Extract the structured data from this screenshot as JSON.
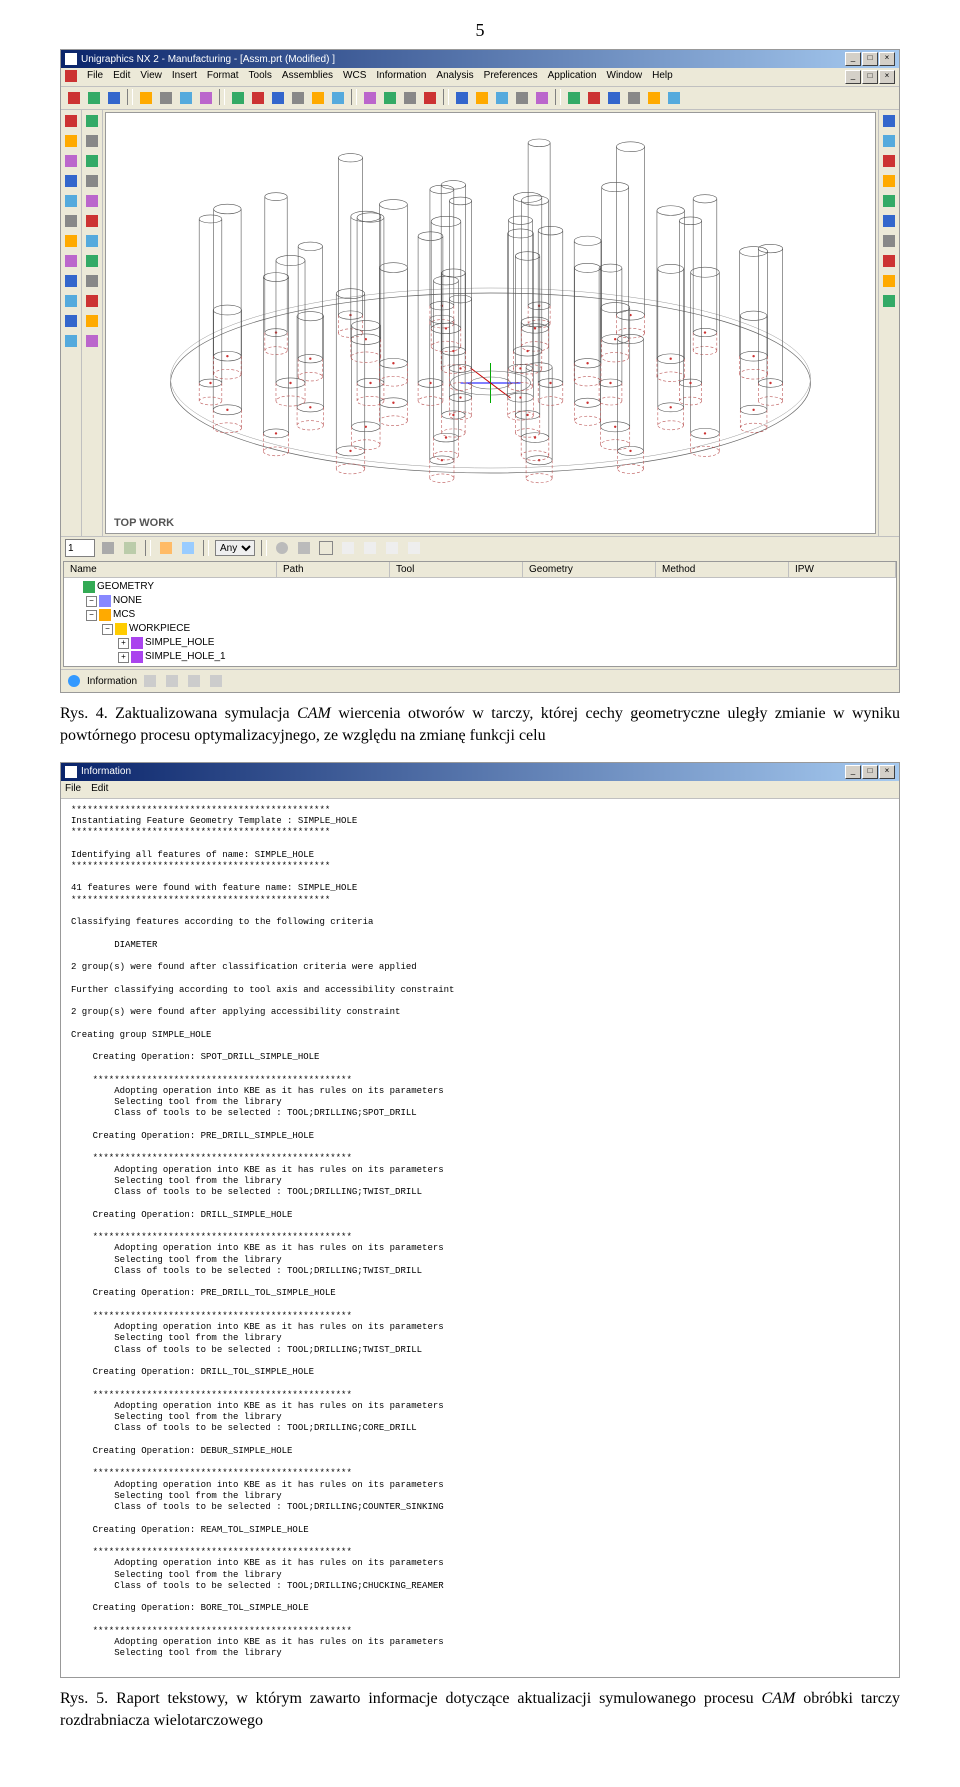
{
  "page_number": "5",
  "fig1": {
    "title": "Unigraphics NX 2 - Manufacturing - [Assm.prt (Modified) ]",
    "menus": [
      "File",
      "Edit",
      "View",
      "Insert",
      "Format",
      "Tools",
      "Assemblies",
      "WCS",
      "Information",
      "Analysis",
      "Preferences",
      "Application",
      "Window",
      "Help"
    ],
    "canvas_label": "TOP WORK",
    "bottom_spin": "1",
    "bottom_select": "Any",
    "tree_cols": [
      "Name",
      "Path",
      "Tool",
      "Geometry",
      "Method",
      "IPW"
    ],
    "tree": [
      {
        "indent": 0,
        "exp": "",
        "icon": "#3a5",
        "label": "GEOMETRY"
      },
      {
        "indent": 1,
        "exp": "−",
        "icon": "#88f",
        "label": "NONE"
      },
      {
        "indent": 1,
        "exp": "−",
        "icon": "#fa0",
        "label": "MCS"
      },
      {
        "indent": 2,
        "exp": "−",
        "icon": "#fc0",
        "label": "WORKPIECE"
      },
      {
        "indent": 3,
        "exp": "+",
        "icon": "#a4e",
        "label": "SIMPLE_HOLE"
      },
      {
        "indent": 3,
        "exp": "+",
        "icon": "#a4e",
        "label": "SIMPLE_HOLE_1"
      }
    ],
    "status_label": "Information"
  },
  "caption1_pre": "Rys. 4. Zaktualizowana symulacja ",
  "caption1_ital": "CAM",
  "caption1_post": " wiercenia otworów w tarczy, której cechy geometryczne uległy zmianie w wyniku powtórnego procesu optymalizacyjnego, ze względu na zmianę funkcji celu",
  "fig2": {
    "title": "Information",
    "menus": [
      "File",
      "Edit"
    ],
    "sep": "************************************************",
    "lines": [
      "Instantiating Feature Geometry Template : SIMPLE_HOLE",
      "",
      "Identifying all features of name: SIMPLE_HOLE",
      "",
      "41 features were found with feature name: SIMPLE_HOLE",
      "",
      "Classifying features according to the following criteria",
      "",
      "        DIAMETER",
      "",
      "2 group(s) were found after classification criteria were applied",
      "",
      "Further classifying according to tool axis and accessibility constraint",
      "",
      "2 group(s) were found after applying accessibility constraint",
      "",
      "Creating group SIMPLE_HOLE",
      ""
    ],
    "ops": [
      {
        "name": "SPOT_DRILL_SIMPLE_HOLE",
        "cls": "TOOL;DRILLING;SPOT_DRILL"
      },
      {
        "name": "PRE_DRILL_SIMPLE_HOLE",
        "cls": "TOOL;DRILLING;TWIST_DRILL"
      },
      {
        "name": "DRILL_SIMPLE_HOLE",
        "cls": "TOOL;DRILLING;TWIST_DRILL"
      },
      {
        "name": "PRE_DRILL_TOL_SIMPLE_HOLE",
        "cls": "TOOL;DRILLING;TWIST_DRILL"
      },
      {
        "name": "DRILL_TOL_SIMPLE_HOLE",
        "cls": "TOOL;DRILLING;CORE_DRILL"
      },
      {
        "name": "DEBUR_SIMPLE_HOLE",
        "cls": "TOOL;DRILLING;COUNTER_SINKING"
      },
      {
        "name": "REAM_TOL_SIMPLE_HOLE",
        "cls": "TOOL;DRILLING;CHUCKING_REAMER"
      },
      {
        "name": "BORE_TOL_SIMPLE_HOLE",
        "cls": ""
      }
    ],
    "op_body": [
      "        Adopting operation into KBE as it has rules on its parameters",
      "        Selecting tool from the library",
      "        Class of tools to be selected : "
    ]
  },
  "caption2_pre": "Rys. 5. Raport tekstowy, w którym zawarto informacje dotyczące aktualizacji symulowanego procesu ",
  "caption2_ital": "CAM",
  "caption2_post": " obróbki tarczy rozdrabniacza wielotarczowego"
}
